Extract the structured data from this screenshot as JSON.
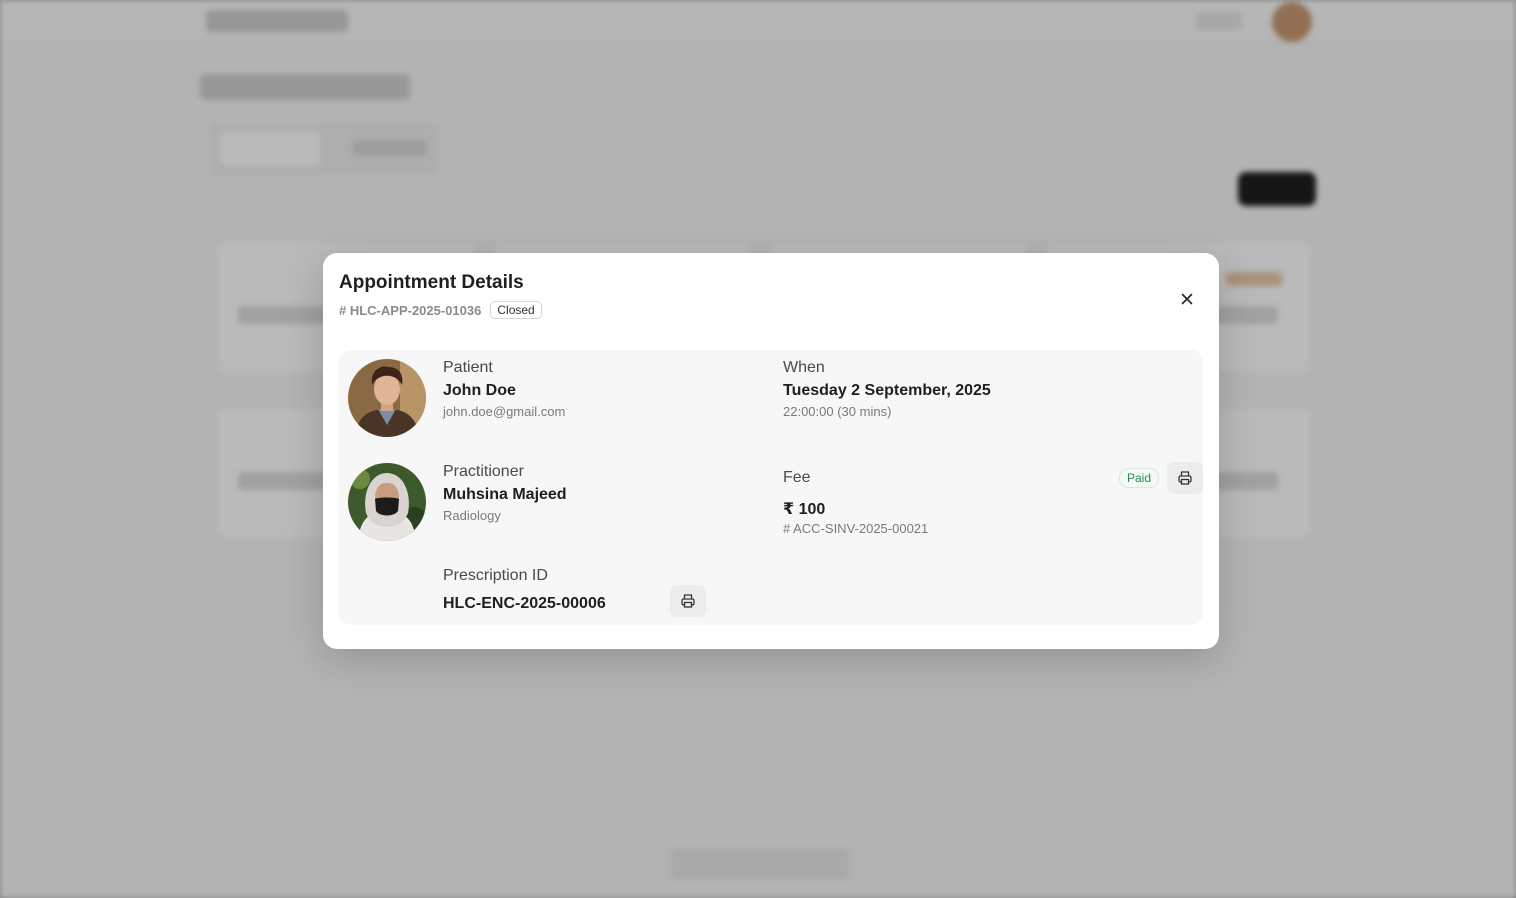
{
  "modal": {
    "title": "Appointment Details",
    "appointment_id": "# HLC-APP-2025-01036",
    "status": "Closed"
  },
  "patient": {
    "label": "Patient",
    "name": "John Doe",
    "email": "john.doe@gmail.com",
    "avatar_icon": "patient-avatar"
  },
  "when": {
    "label": "When",
    "date": "Tuesday 2 September, 2025",
    "time": "22:00:00 (30 mins)"
  },
  "practitioner": {
    "label": "Practitioner",
    "name": "Muhsina Majeed",
    "department": "Radiology",
    "avatar_icon": "practitioner-avatar"
  },
  "fee": {
    "label": "Fee",
    "status": "Paid",
    "amount": "₹ 100",
    "invoice_id": "# ACC-SINV-2025-00021"
  },
  "prescription": {
    "label": "Prescription ID",
    "id": "HLC-ENC-2025-00006"
  },
  "colors": {
    "paid_green": "#2f8a4c",
    "overlay": "#b4b4b4",
    "panel_bg": "#f7f7f7"
  }
}
